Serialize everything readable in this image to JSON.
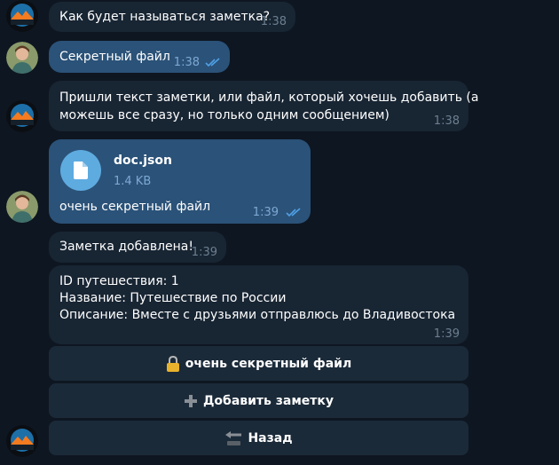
{
  "messages": [
    {
      "text": "Как будет называться заметка?",
      "time": "1:38"
    },
    {
      "text": "Секретный файл",
      "time": "1:38"
    },
    {
      "line1": "Пришли текст заметки, или файл, который хочешь добавить (а",
      "line2": "можешь все сразу, но только одним сообщением)",
      "time": "1:38"
    },
    {
      "file_name": "doc.json",
      "file_size": "1.4 KB",
      "caption": "очень секретный файл",
      "time": "1:39"
    },
    {
      "text": "Заметка добавлена!",
      "time": "1:39"
    },
    {
      "line1": "ID путешествия: 1",
      "line2": "Название: Путешествие по России",
      "line3": "Описание: Вместе с друзьями отправлюсь до Владивостока",
      "time": "1:39"
    }
  ],
  "keyboard": [
    {
      "label": "очень секретный файл",
      "icon": "lock-icon"
    },
    {
      "label": "Добавить заметку",
      "icon": "plus-icon"
    },
    {
      "label": "Назад",
      "icon": "back-arrow-icon"
    }
  ],
  "colors": {
    "background": "#0e1621",
    "incoming": "#182533",
    "outgoing": "#2b5278",
    "file_icon": "#5eabe0",
    "ticks": "#4fa0e6"
  }
}
